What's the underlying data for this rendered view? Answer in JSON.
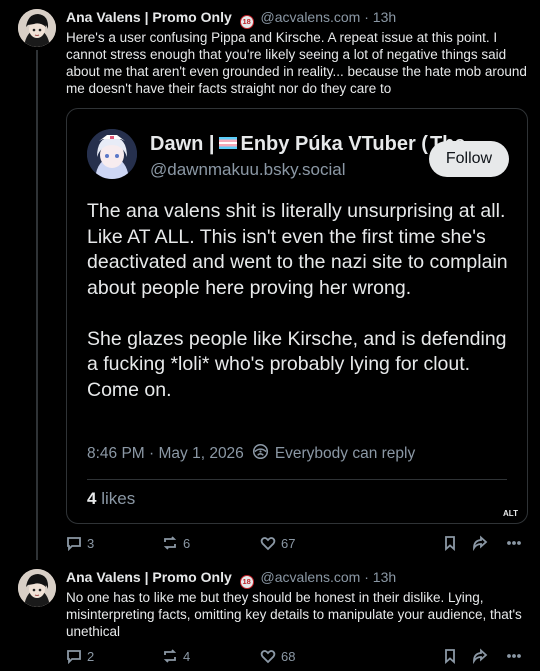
{
  "posts": [
    {
      "author_name": "Ana Valens | Promo Only",
      "badge": "18",
      "handle": "@acvalens.com",
      "time": "· 13h",
      "text": "Here's a user confusing Pippa and Kirsche. A repeat issue at this point. I cannot stress enough that you're likely seeing a lot of negative things said about me that aren't even grounded in reality... because the hate mob around me doesn't have their facts straight nor do they care to",
      "actions": {
        "comments": "3",
        "reposts": "6",
        "likes": "67"
      }
    },
    {
      "author_name": "Ana Valens | Promo Only",
      "badge": "18",
      "handle": "@acvalens.com",
      "time": "· 13h",
      "text": "No one has to like me but they should be honest in their dislike. Lying, misinterpreting facts, omitting key details to manipulate your audience, that's unethical",
      "actions": {
        "comments": "2",
        "reposts": "4",
        "likes": "68"
      }
    }
  ],
  "quote": {
    "name_prefix": "Dawn |",
    "name_suffix": "Enby Púka VTuber (",
    "name_tail": "The",
    "handle": "@dawnmakuu.bsky.social",
    "follow_label": "Follow",
    "text": "The ana valens shit is literally unsurprising at all. Like AT ALL. This isn't even the first time she's deactivated and went to the nazi site to complain about people here proving her wrong.\n\nShe glazes people like Kirsche, and is defending a fucking *loli* who's probably lying for clout. Come on.",
    "date": "8:46 PM · May 1, 2026",
    "reply_setting": "Everybody can reply",
    "likes_count": "4",
    "likes_label": "likes",
    "alt_badge": "ALT"
  },
  "colors": {
    "background": "#000000",
    "text": "#e7e9ea",
    "muted": "#8b98a5",
    "border": "#2f3336"
  },
  "icons": [
    "comment-icon",
    "repost-icon",
    "like-icon",
    "bookmark-icon",
    "share-icon",
    "more-icon",
    "globe-icon"
  ]
}
